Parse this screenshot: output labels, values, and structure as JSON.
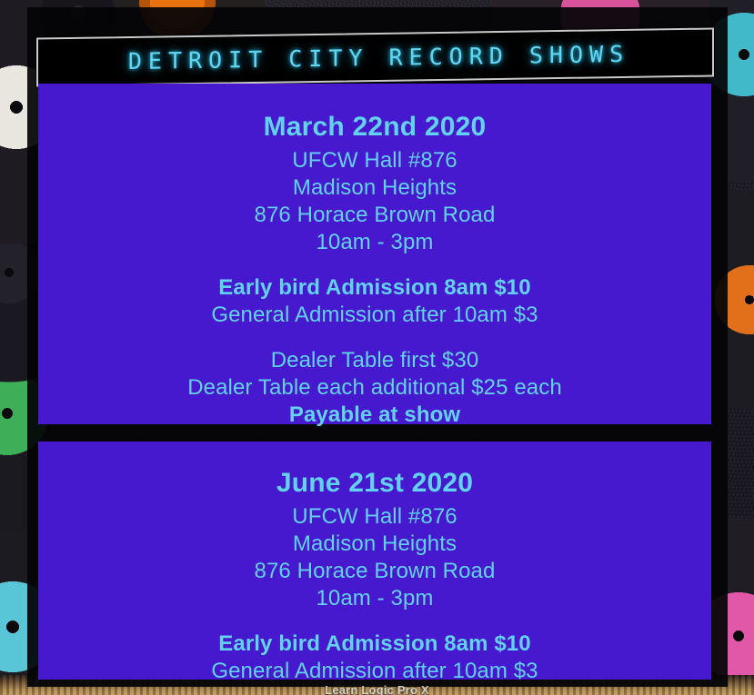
{
  "banner": {
    "title": "DETROIT CITY RECORD SHOWS"
  },
  "events": [
    {
      "date": "March 22nd 2020",
      "venue": "UFCW Hall #876",
      "city": "Madison Heights",
      "address": "876 Horace Brown Road",
      "hours": "10am - 3pm",
      "early_bird": "Early bird Admission 8am $10",
      "general_admission": "General Admission after 10am $3",
      "dealer_first": "Dealer Table first $30",
      "dealer_additional": "Dealer Table each additional $25 each",
      "payment_note": "Payable at show"
    },
    {
      "date": "June 21st 2020",
      "venue": "UFCW Hall #876",
      "city": "Madison Heights",
      "address": "876 Horace Brown Road",
      "hours": "10am - 3pm",
      "early_bird": "Early bird Admission 8am $10",
      "general_admission": "General Admission after 10am $3"
    }
  ],
  "watermark": {
    "text": "Learn Logic Pro X"
  },
  "colors": {
    "card_background": "#4719ce",
    "text_accent": "#62d1f2",
    "banner_background": "#000000",
    "banner_border": "#c9c9c9",
    "banner_text": "#63d6f2"
  }
}
